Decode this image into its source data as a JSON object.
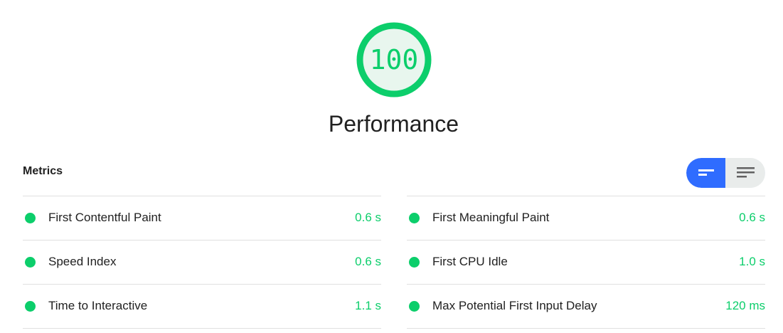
{
  "score": {
    "value": 100,
    "display": "100",
    "color": "#0cce6b"
  },
  "category": {
    "title": "Performance"
  },
  "metrics": {
    "header": "Metrics",
    "toggle": {
      "active": "compact-view",
      "active_color": "#2f6cff"
    },
    "left": [
      {
        "label": "First Contentful Paint",
        "value": "0.6 s",
        "status": "pass"
      },
      {
        "label": "Speed Index",
        "value": "0.6 s",
        "status": "pass"
      },
      {
        "label": "Time to Interactive",
        "value": "1.1 s",
        "status": "pass"
      }
    ],
    "right": [
      {
        "label": "First Meaningful Paint",
        "value": "0.6 s",
        "status": "pass"
      },
      {
        "label": "First CPU Idle",
        "value": "1.0 s",
        "status": "pass"
      },
      {
        "label": "Max Potential First Input Delay",
        "value": "120 ms",
        "status": "pass"
      }
    ]
  },
  "colors": {
    "pass": "#0cce6b",
    "text": "#212121",
    "divider": "#e0e0e0"
  }
}
